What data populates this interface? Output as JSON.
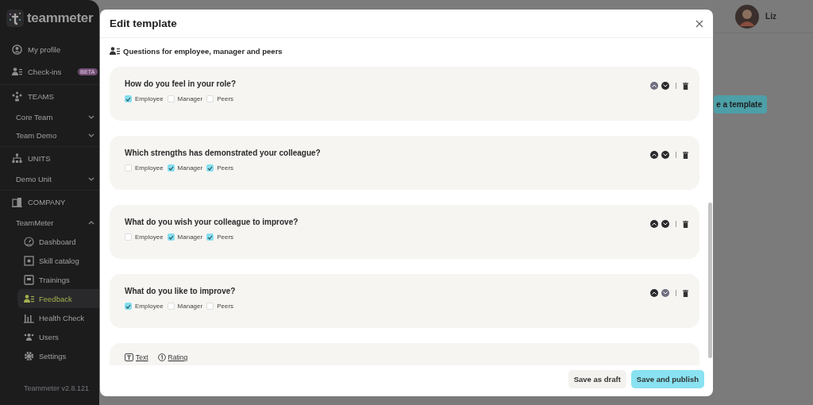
{
  "sidebar": {
    "logo": "teammeter",
    "nav": [
      {
        "label": "My profile"
      },
      {
        "label": "Check-ins",
        "badge": "BETA"
      }
    ],
    "sections": [
      {
        "title": "TEAMS",
        "groups": [
          {
            "label": "Core Team",
            "expanded": false
          },
          {
            "label": "Team Demo",
            "expanded": false
          }
        ]
      },
      {
        "title": "UNITS",
        "groups": [
          {
            "label": "Demo Unit",
            "expanded": false
          }
        ]
      },
      {
        "title": "COMPANY",
        "groups": [
          {
            "label": "TeamMeter",
            "expanded": true,
            "children": [
              {
                "label": "Dashboard",
                "selected": false
              },
              {
                "label": "Skill catalog",
                "selected": false
              },
              {
                "label": "Trainings",
                "selected": false
              },
              {
                "label": "Feedback",
                "selected": true
              },
              {
                "label": "Health Check",
                "selected": false
              },
              {
                "label": "Users",
                "selected": false
              },
              {
                "label": "Settings",
                "selected": false
              }
            ]
          }
        ]
      }
    ],
    "version": "Teammeter v2.8.121"
  },
  "header": {
    "user_name": "Liz"
  },
  "background_button": "e a template",
  "modal": {
    "title": "Edit template",
    "section_title": "Questions for employee, manager and peers",
    "questions": [
      {
        "text": "How do you feel in your role?",
        "up_disabled": true,
        "down_disabled": false,
        "options": [
          {
            "label": "Employee",
            "checked": true
          },
          {
            "label": "Manager",
            "checked": false
          },
          {
            "label": "Peers",
            "checked": false
          }
        ]
      },
      {
        "text": "Which strengths has demonstrated your colleague?",
        "up_disabled": false,
        "down_disabled": false,
        "options": [
          {
            "label": "Employee",
            "checked": false
          },
          {
            "label": "Manager",
            "checked": true
          },
          {
            "label": "Peers",
            "checked": true
          }
        ]
      },
      {
        "text": "What do you wish your colleague to improve?",
        "up_disabled": false,
        "down_disabled": false,
        "options": [
          {
            "label": "Employee",
            "checked": false
          },
          {
            "label": "Manager",
            "checked": true
          },
          {
            "label": "Peers",
            "checked": true
          }
        ]
      },
      {
        "text": "What do you like to improve?",
        "up_disabled": false,
        "down_disabled": true,
        "options": [
          {
            "label": "Employee",
            "checked": true
          },
          {
            "label": "Manager",
            "checked": false
          },
          {
            "label": "Peers",
            "checked": false
          }
        ]
      }
    ],
    "add_links": [
      {
        "label": "Text",
        "kind": "text"
      },
      {
        "label": "Rating",
        "kind": "rating"
      }
    ],
    "buttons": [
      {
        "label": "Save as draft",
        "kind": "secondary"
      },
      {
        "label": "Save and publish",
        "kind": "primary"
      }
    ]
  }
}
